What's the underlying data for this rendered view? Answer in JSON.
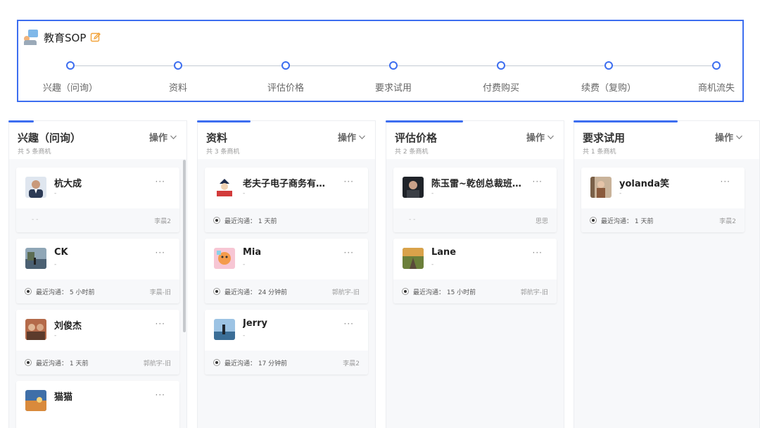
{
  "sop": {
    "title": "教育SOP",
    "icons": {
      "logo": "education-sop-logo",
      "edit": "edit-icon"
    },
    "stages": [
      "兴趣（问询）",
      "资料",
      "评估价格",
      "要求试用",
      "付费购买",
      "续费（复购）",
      "商机流失"
    ]
  },
  "columns": [
    {
      "title": "兴趣（问询）",
      "count": "共 5 条商机",
      "op": "操作",
      "cards": [
        {
          "name": "杭大成",
          "sub": "-",
          "comm": "- -",
          "owner": "李晨2",
          "avatar": "portrait-suit"
        },
        {
          "name": "CK",
          "sub": "-",
          "comm": "最近沟通： 5 小时前",
          "owner": "李晨-旧",
          "avatar": "landscape-lake"
        },
        {
          "name": "刘俊杰",
          "sub": "-",
          "comm": "最近沟通： 1 天前",
          "owner": "郭航宇-旧",
          "avatar": "portrait-group"
        },
        {
          "name": "猫猫",
          "sub": "",
          "comm": "",
          "owner": "",
          "avatar": "landscape-sunset"
        }
      ]
    },
    {
      "title": "资料",
      "count": "共 3 条商机",
      "op": "操作",
      "cards": [
        {
          "name": "老夫子电子商务有限公司",
          "sub": "-",
          "comm": "最近沟通： 1 天前",
          "owner": "",
          "avatar": "cartoon-logo"
        },
        {
          "name": "Mia",
          "sub": "-",
          "comm": "最近沟通： 24 分钟前",
          "owner": "郭航宇-旧",
          "avatar": "cartoon-colorful"
        },
        {
          "name": "Jerry",
          "sub": "-",
          "comm": "最近沟通： 17 分钟前",
          "owner": "李晨2",
          "avatar": "landscape-sea"
        }
      ]
    },
    {
      "title": "评估价格",
      "count": "共 2 条商机",
      "op": "操作",
      "cards": [
        {
          "name": "陈玉雷~乾创总裁班学员",
          "sub": "-",
          "comm": "- -",
          "owner": "思思",
          "avatar": "portrait-dark"
        },
        {
          "name": "Lane",
          "sub": "-",
          "comm": "最近沟通： 15 小时前",
          "owner": "郭航宇-旧",
          "avatar": "landscape-road"
        }
      ]
    },
    {
      "title": "要求试用",
      "count": "共 1 条商机",
      "op": "操作",
      "cards": [
        {
          "name": "yolanda笑",
          "sub": "-",
          "comm": "最近沟通： 1 天前",
          "owner": "李晨2",
          "avatar": "portrait-woman"
        }
      ]
    }
  ],
  "colors": {
    "accent": "#3d6ef0",
    "column_bg": "#f7f8fa",
    "card_foot_bg": "#f7f8fa"
  }
}
